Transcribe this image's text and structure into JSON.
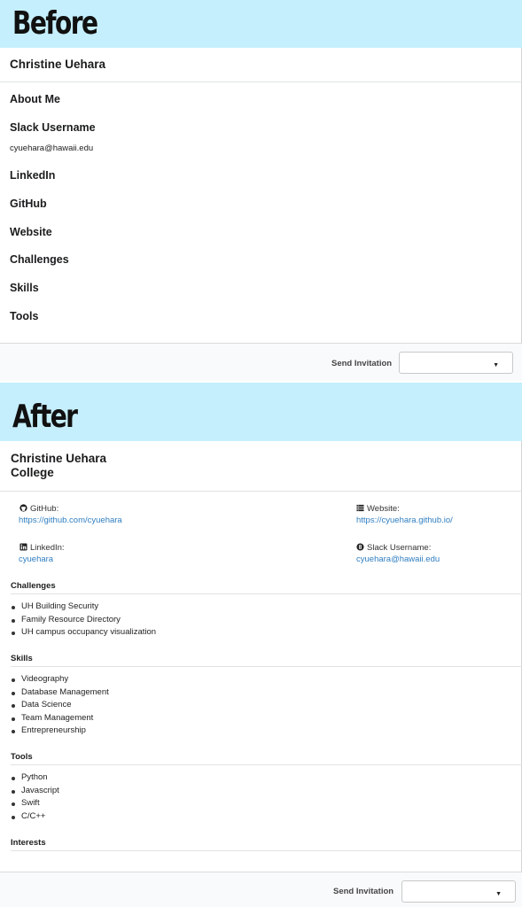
{
  "before": {
    "banner_title": "Before",
    "name": "Christine Uehara",
    "fields": [
      {
        "label": "About Me"
      },
      {
        "label": "Slack Username",
        "value": "cyuehara@hawaii.edu"
      },
      {
        "label": "LinkedIn"
      },
      {
        "label": "GitHub"
      },
      {
        "label": "Website"
      },
      {
        "label": "Challenges"
      },
      {
        "label": "Skills"
      },
      {
        "label": "Tools"
      }
    ],
    "footer": {
      "send_label": "Send Invitation",
      "dropdown_value": ""
    }
  },
  "after": {
    "banner_title": "After",
    "name": "Christine Uehara",
    "subtitle": "College",
    "github": {
      "label": "GitHub:",
      "link": "https://github.com/cyuehara",
      "icon": "github-icon"
    },
    "website": {
      "label": "Website:",
      "link": "https://cyuehara.github.io/",
      "icon": "website-icon"
    },
    "linkedin": {
      "label": "LinkedIn:",
      "link": "cyuehara",
      "icon": "linkedin-icon"
    },
    "slack": {
      "label": "Slack Username:",
      "link": "cyuehara@hawaii.edu",
      "icon": "slack-icon"
    },
    "challenges": {
      "title": "Challenges",
      "items": [
        "UH Building Security",
        "Family Resource Directory",
        "UH campus occupancy visualization"
      ]
    },
    "skills": {
      "title": "Skills",
      "items": [
        "Videography",
        "Database Management",
        "Data Science",
        "Team Management",
        "Entrepreneurship"
      ]
    },
    "tools": {
      "title": "Tools",
      "items": [
        "Python",
        "Javascript",
        "Swift",
        "C/C++"
      ]
    },
    "interests": {
      "title": "Interests",
      "items": []
    },
    "footer": {
      "send_label": "Send Invitation",
      "dropdown_value": ""
    }
  },
  "colors": {
    "banner": "#c5effd",
    "link": "#2f7ec1",
    "footer": "#f9fafb"
  }
}
